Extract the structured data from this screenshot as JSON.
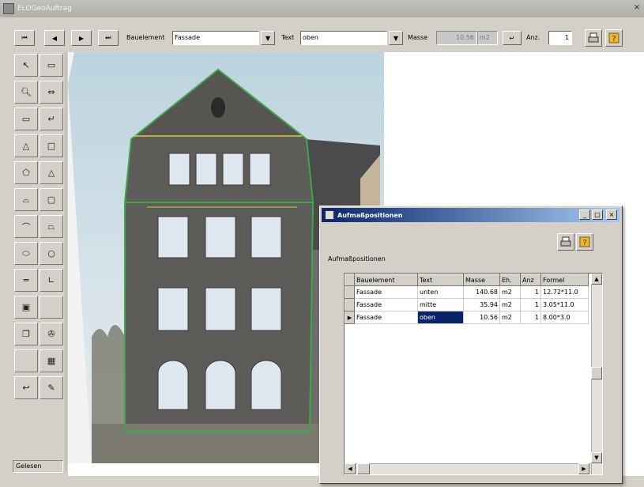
{
  "window": {
    "title": "ELOGeoAuftrag",
    "close": "×"
  },
  "toolbar": {
    "first": "⏮",
    "prev": "◀",
    "next": "▶",
    "last": "⏭",
    "bauelement_label": "Bauelement",
    "bauelement_value": "Fassade",
    "text_label": "Text",
    "text_value": "oben",
    "masse_label": "Masse",
    "masse_value": "10.56",
    "unit_value": "m2",
    "anz_label": "Anz.",
    "anz_value": "1",
    "dropdown": "▼"
  },
  "status": {
    "text": "Gelesen"
  },
  "dialog": {
    "title": "Aufmaßpositionen",
    "min": "_",
    "max": "□",
    "close": "×",
    "group_label": "Aufmaßpositionen",
    "columns": [
      "Bauelement",
      "Text",
      "Masse",
      "Eh.",
      "Anz",
      "Formel"
    ],
    "rows": [
      {
        "bauelement": "Fassade",
        "text": "unten",
        "masse": "140.68",
        "eh": "m2",
        "anz": "1",
        "formel": "12.72*11.0"
      },
      {
        "bauelement": "Fassade",
        "text": "mitte",
        "masse": "35.94",
        "eh": "m2",
        "anz": "1",
        "formel": "3.05*11.0"
      },
      {
        "bauelement": "Fassade",
        "text": "oben",
        "masse": "10.56",
        "eh": "m2",
        "anz": "1",
        "formel": "8.00*3.0"
      }
    ]
  },
  "colors": {
    "dialog_title_start": "#0a246a",
    "dialog_title_end": "#a6caf0",
    "outline_green": "#3fa64a",
    "outline_yellow": "#d8c83a",
    "accent_orange": "#e8b830"
  }
}
